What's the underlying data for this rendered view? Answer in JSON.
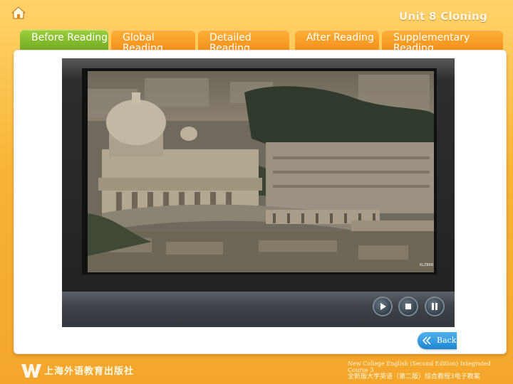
{
  "header": {
    "unit_title": "Unit 8 Cloning"
  },
  "tabs": [
    {
      "label": "Before Reading",
      "active": true
    },
    {
      "label": "Global Reading",
      "active": false
    },
    {
      "label": "Detailed Reading",
      "active": false
    },
    {
      "label": "After Reading",
      "active": false
    },
    {
      "label": "Supplementary Reading",
      "active": false
    }
  ],
  "player": {
    "watermark": "KLZ868",
    "buttons": [
      "play",
      "stop",
      "pause"
    ]
  },
  "navigation": {
    "back_label": "Back"
  },
  "footer": {
    "publisher": "上海外语教育出版社",
    "course_en": "New College English (Second Edition) Integrated Course 3",
    "course_zh": "全新版大学英语（第二版）综合教程3电子教案"
  },
  "colors": {
    "active_tab": "#7cb62a",
    "inactive_tab": "#f59b20",
    "back_button": "#2a93d8"
  }
}
